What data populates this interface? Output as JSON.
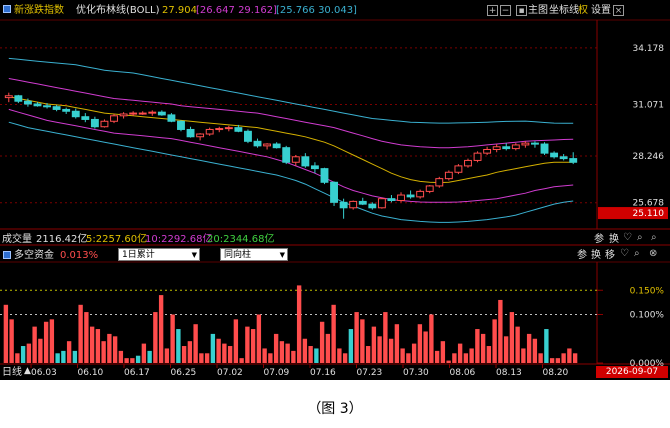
{
  "header": {
    "index_name": "新涨跌指数",
    "indicator": "优化布林线(BOLL)",
    "mid": "27.904",
    "upper_lower": "[26.647 29.162]",
    "band": "[25.766 30.043]",
    "tools": [
      "主图",
      "坐标线",
      "权",
      "设置"
    ]
  },
  "volume_bar": {
    "label": "成交量",
    "total": "2116.42亿",
    "ma5": "5:2257.60亿",
    "ma10": "10:2292.68亿",
    "ma20": "20:2344.68亿",
    "tools": [
      "参",
      "换"
    ]
  },
  "capital_panel": {
    "title": "多空资金",
    "value": "0.013%",
    "select1": "1日累计",
    "select2": "同向柱",
    "tools": [
      "参",
      "换",
      "移"
    ]
  },
  "footer": {
    "period": "日线",
    "dates": [
      "06.03",
      "06.10",
      "06.17",
      "06.25",
      "07.02",
      "07.09",
      "07.16",
      "07.23",
      "07.30",
      "08.06",
      "08.13",
      "08.20"
    ],
    "current_date": "2026-09-07"
  },
  "caption": "（图 3）",
  "colors": {
    "up": "#ff4d4d",
    "down": "#38d0d0",
    "mid_line": "#d4b000",
    "inner_band": "#d03cd0",
    "outer_band": "#3ab0d0",
    "price_tag": "#d00000"
  },
  "chart_data": [
    {
      "type": "candlestick",
      "title": "优化布林线(BOLL)",
      "y_ticks": [
        34.178,
        31.071,
        28.246,
        25.678
      ],
      "current_price": 25.11,
      "ylim": [
        24.4,
        35.6
      ],
      "series": [
        {
          "name": "K",
          "ohlc": [
            [
              31.45,
              31.72,
              31.2,
              31.55
            ],
            [
              31.55,
              31.6,
              31.15,
              31.25
            ],
            [
              31.25,
              31.4,
              30.95,
              31.1
            ],
            [
              31.1,
              31.2,
              30.95,
              31.0
            ],
            [
              31.0,
              31.15,
              30.85,
              30.95
            ],
            [
              30.95,
              31.05,
              30.7,
              30.8
            ],
            [
              30.8,
              30.9,
              30.55,
              30.7
            ],
            [
              30.7,
              30.85,
              30.3,
              30.4
            ],
            [
              30.4,
              30.6,
              30.1,
              30.25
            ],
            [
              30.25,
              30.4,
              29.75,
              29.85
            ],
            [
              29.85,
              30.25,
              29.8,
              30.15
            ],
            [
              30.15,
              30.55,
              30.05,
              30.45
            ],
            [
              30.45,
              30.65,
              30.3,
              30.55
            ],
            [
              30.55,
              30.7,
              30.45,
              30.6
            ],
            [
              30.6,
              30.7,
              30.5,
              30.6
            ],
            [
              30.6,
              30.75,
              30.45,
              30.65
            ],
            [
              30.65,
              30.75,
              30.45,
              30.5
            ],
            [
              30.5,
              30.6,
              30.1,
              30.15
            ],
            [
              30.15,
              30.2,
              29.6,
              29.7
            ],
            [
              29.7,
              29.85,
              29.25,
              29.3
            ],
            [
              29.3,
              29.5,
              29.1,
              29.45
            ],
            [
              29.45,
              29.8,
              29.35,
              29.7
            ],
            [
              29.7,
              29.85,
              29.55,
              29.75
            ],
            [
              29.75,
              29.9,
              29.6,
              29.8
            ],
            [
              29.8,
              29.95,
              29.55,
              29.6
            ],
            [
              29.6,
              29.7,
              28.95,
              29.05
            ],
            [
              29.05,
              29.2,
              28.7,
              28.8
            ],
            [
              28.8,
              28.95,
              28.6,
              28.9
            ],
            [
              28.9,
              29.0,
              28.65,
              28.7
            ],
            [
              28.7,
              28.8,
              27.8,
              27.9
            ],
            [
              27.9,
              28.3,
              27.7,
              28.2
            ],
            [
              28.2,
              28.4,
              27.6,
              27.7
            ],
            [
              27.7,
              27.9,
              27.3,
              27.55
            ],
            [
              27.55,
              27.6,
              26.7,
              26.8
            ],
            [
              26.8,
              26.85,
              25.5,
              25.7
            ],
            [
              25.7,
              25.9,
              24.8,
              25.4
            ],
            [
              25.4,
              25.8,
              25.3,
              25.75
            ],
            [
              25.75,
              25.95,
              25.55,
              25.6
            ],
            [
              25.6,
              25.7,
              25.3,
              25.4
            ],
            [
              25.4,
              25.95,
              25.35,
              25.9
            ],
            [
              25.9,
              26.1,
              25.7,
              25.8
            ],
            [
              25.8,
              26.25,
              25.7,
              26.1
            ],
            [
              26.1,
              26.35,
              25.9,
              26.0
            ],
            [
              26.0,
              26.4,
              25.9,
              26.3
            ],
            [
              26.3,
              26.65,
              26.2,
              26.6
            ],
            [
              26.6,
              27.1,
              26.5,
              27.0
            ],
            [
              27.0,
              27.45,
              26.9,
              27.35
            ],
            [
              27.35,
              27.8,
              27.25,
              27.7
            ],
            [
              27.7,
              28.1,
              27.6,
              28.0
            ],
            [
              28.0,
              28.5,
              27.9,
              28.4
            ],
            [
              28.4,
              28.75,
              28.3,
              28.6
            ],
            [
              28.6,
              28.9,
              28.45,
              28.75
            ],
            [
              28.75,
              28.95,
              28.55,
              28.65
            ],
            [
              28.65,
              28.95,
              28.55,
              28.85
            ],
            [
              28.85,
              29.05,
              28.7,
              28.95
            ],
            [
              28.95,
              29.05,
              28.7,
              28.9
            ],
            [
              28.9,
              29.0,
              28.3,
              28.4
            ],
            [
              28.4,
              28.5,
              28.1,
              28.2
            ],
            [
              28.2,
              28.35,
              28.0,
              28.1
            ],
            [
              28.1,
              28.45,
              27.8,
              27.9
            ]
          ]
        },
        {
          "name": "MID",
          "values": [
            31.5,
            31.4,
            31.3,
            31.2,
            31.1,
            31.05,
            31.0,
            30.9,
            30.8,
            30.7,
            30.6,
            30.55,
            30.5,
            30.45,
            30.4,
            30.35,
            30.3,
            30.25,
            30.2,
            30.15,
            30.1,
            30.05,
            30.0,
            29.95,
            29.9,
            29.85,
            29.8,
            29.7,
            29.6,
            29.5,
            29.4,
            29.3,
            29.15,
            29.0,
            28.8,
            28.55,
            28.3,
            28.05,
            27.8,
            27.55,
            27.3,
            27.1,
            26.95,
            26.85,
            26.8,
            26.78,
            26.8,
            26.9,
            27.0,
            27.1,
            27.2,
            27.35,
            27.45,
            27.55,
            27.65,
            27.75,
            27.85,
            27.9,
            27.9,
            27.9
          ]
        },
        {
          "name": "UP1",
          "values": [
            32.5,
            32.4,
            32.3,
            32.2,
            32.1,
            32.0,
            31.9,
            31.8,
            31.7,
            31.6,
            31.5,
            31.4,
            31.35,
            31.3,
            31.25,
            31.2,
            31.15,
            31.1,
            31.0,
            30.95,
            30.9,
            30.85,
            30.8,
            30.75,
            30.7,
            30.65,
            30.6,
            30.5,
            30.4,
            30.3,
            30.2,
            30.1,
            30.0,
            29.9,
            29.8,
            29.65,
            29.5,
            29.35,
            29.2,
            29.05,
            28.95,
            28.85,
            28.8,
            28.75,
            28.72,
            28.7,
            28.7,
            28.72,
            28.75,
            28.8,
            28.85,
            28.9,
            28.95,
            29.0,
            29.05,
            29.08,
            29.1,
            29.12,
            29.15,
            29.16
          ]
        },
        {
          "name": "DN1",
          "values": [
            30.8,
            30.65,
            30.5,
            30.35,
            30.2,
            30.1,
            30.0,
            29.9,
            29.8,
            29.7,
            29.6,
            29.5,
            29.45,
            29.4,
            29.35,
            29.3,
            29.25,
            29.2,
            29.1,
            29.0,
            28.9,
            28.8,
            28.7,
            28.6,
            28.5,
            28.4,
            28.3,
            28.2,
            28.05,
            27.9,
            27.7,
            27.5,
            27.3,
            27.05,
            26.8,
            26.55,
            26.35,
            26.2,
            26.05,
            25.95,
            25.85,
            25.8,
            25.75,
            25.72,
            25.7,
            25.7,
            25.7,
            25.72,
            25.75,
            25.8,
            25.85,
            25.9,
            26.0,
            26.1,
            26.2,
            26.35,
            26.45,
            26.55,
            26.6,
            26.65
          ]
        },
        {
          "name": "UP2",
          "values": [
            33.6,
            33.55,
            33.5,
            33.45,
            33.4,
            33.35,
            33.3,
            33.25,
            33.15,
            33.05,
            32.95,
            32.9,
            32.85,
            32.8,
            32.7,
            32.6,
            32.5,
            32.4,
            32.3,
            32.2,
            32.1,
            32.0,
            31.9,
            31.8,
            31.7,
            31.6,
            31.5,
            31.4,
            31.3,
            31.2,
            31.1,
            31.0,
            30.9,
            30.8,
            30.7,
            30.6,
            30.5,
            30.4,
            30.3,
            30.25,
            30.2,
            30.15,
            30.1,
            30.08,
            30.06,
            30.05,
            30.05,
            30.06,
            30.07,
            30.08,
            30.1,
            30.12,
            30.14,
            30.15,
            30.16,
            30.12,
            30.08,
            30.05,
            30.04,
            30.04
          ]
        },
        {
          "name": "DN2",
          "values": [
            30.1,
            29.95,
            29.8,
            29.7,
            29.6,
            29.5,
            29.4,
            29.3,
            29.2,
            29.1,
            29.0,
            28.9,
            28.8,
            28.7,
            28.6,
            28.5,
            28.4,
            28.3,
            28.2,
            28.1,
            28.0,
            27.9,
            27.8,
            27.7,
            27.6,
            27.5,
            27.4,
            27.3,
            27.2,
            27.05,
            26.9,
            26.7,
            26.45,
            26.2,
            25.95,
            25.7,
            25.5,
            25.3,
            25.1,
            24.95,
            24.85,
            24.75,
            24.7,
            24.65,
            24.62,
            24.6,
            24.6,
            24.62,
            24.65,
            24.7,
            24.75,
            24.82,
            24.9,
            25.0,
            25.15,
            25.3,
            25.45,
            25.6,
            25.7,
            25.77
          ]
        }
      ]
    },
    {
      "type": "bar",
      "title": "多空资金",
      "y_ticks": [
        "0.150%",
        "0.100%",
        "0.000%"
      ],
      "ylim": [
        0,
        0.2
      ],
      "reference_lines": [
        0.15,
        0.1
      ],
      "values": [
        0.12,
        0.09,
        0.02,
        0.035,
        0.04,
        0.075,
        0.05,
        0.085,
        0.09,
        0.02,
        0.025,
        0.045,
        0.025,
        0.12,
        0.105,
        0.075,
        0.07,
        0.045,
        0.06,
        0.055,
        0.025,
        0.01,
        0.01,
        0.015,
        0.04,
        0.025,
        0.105,
        0.14,
        0.03,
        0.1,
        0.07,
        0.035,
        0.045,
        0.08,
        0.02,
        0.02,
        0.06,
        0.05,
        0.04,
        0.035,
        0.09,
        0.01,
        0.075,
        0.07,
        0.1,
        0.03,
        0.02,
        0.06,
        0.045,
        0.04,
        0.025,
        0.16,
        0.05,
        0.035,
        0.03,
        0.085,
        0.06,
        0.12,
        0.03,
        0.02,
        0.07,
        0.105,
        0.09,
        0.035,
        0.075,
        0.055,
        0.105,
        0.05,
        0.08,
        0.03,
        0.02,
        0.04,
        0.08,
        0.065,
        0.1,
        0.025,
        0.045,
        0.005,
        0.02,
        0.04,
        0.02,
        0.03,
        0.07,
        0.06,
        0.035,
        0.09,
        0.13,
        0.055,
        0.105,
        0.075,
        0.03,
        0.06,
        0.05,
        0.02,
        0.07,
        0.01,
        0.01,
        0.02,
        0.03,
        0.02
      ],
      "direction": [
        1,
        1,
        1,
        0,
        1,
        1,
        1,
        1,
        1,
        0,
        0,
        1,
        0,
        1,
        1,
        1,
        1,
        1,
        1,
        1,
        1,
        1,
        1,
        0,
        1,
        0,
        1,
        1,
        1,
        1,
        0,
        1,
        1,
        1,
        1,
        1,
        0,
        1,
        1,
        1,
        1,
        1,
        1,
        1,
        1,
        1,
        1,
        1,
        1,
        1,
        1,
        1,
        1,
        1,
        0,
        1,
        1,
        1,
        1,
        1,
        0,
        1,
        1,
        1,
        1,
        1,
        1,
        1,
        1,
        1,
        1,
        1,
        1,
        1,
        1,
        1,
        1,
        1,
        1,
        1,
        1,
        1,
        1,
        1,
        1,
        1,
        1,
        1,
        1,
        1,
        1,
        1,
        1,
        1,
        0,
        1,
        1,
        1,
        1,
        1
      ]
    }
  ]
}
